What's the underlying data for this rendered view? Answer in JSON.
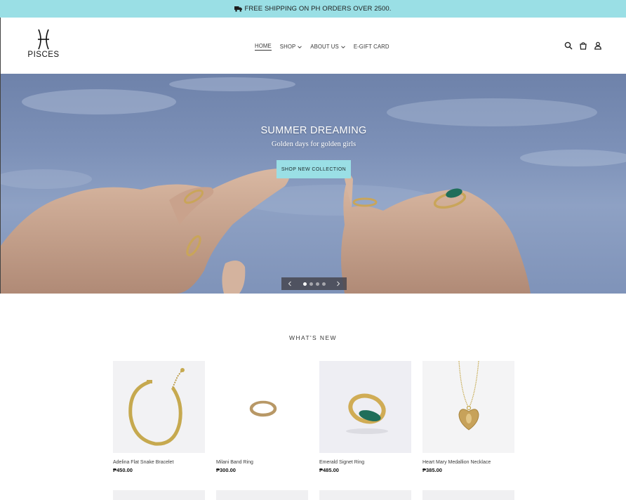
{
  "announcement": {
    "text": "FREE SHIPPING ON PH ORDERS OVER 2500."
  },
  "brand": {
    "name": "PISCES"
  },
  "nav": {
    "items": [
      {
        "label": "HOME",
        "active": true,
        "dropdown": false
      },
      {
        "label": "SHOP",
        "active": false,
        "dropdown": true
      },
      {
        "label": "ABOUT US",
        "active": false,
        "dropdown": true
      },
      {
        "label": "E-GIFT CARD",
        "active": false,
        "dropdown": false
      }
    ]
  },
  "header_icons": [
    "search-icon",
    "cart-icon",
    "account-icon"
  ],
  "hero": {
    "title": "SUMMER DREAMING",
    "subtitle": "Golden days for golden girls",
    "button": "SHOP NEW COLLECTION",
    "slides": 4,
    "active_slide": 1
  },
  "whats_new": {
    "title": "WHAT'S NEW",
    "products": [
      {
        "name": "Adelina Flat Snake Bracelet",
        "price": "₱450.00"
      },
      {
        "name": "Milani Band Ring",
        "price": "₱300.00"
      },
      {
        "name": "Emerald Signet Ring",
        "price": "₱485.00"
      },
      {
        "name": "Heart Mary Medallion Necklace",
        "price": "₱385.00"
      }
    ]
  },
  "colors": {
    "accent": "#9adfe5",
    "text": "#3a3a3a",
    "gold": "#c9a55a",
    "emerald": "#1f6e5a"
  }
}
